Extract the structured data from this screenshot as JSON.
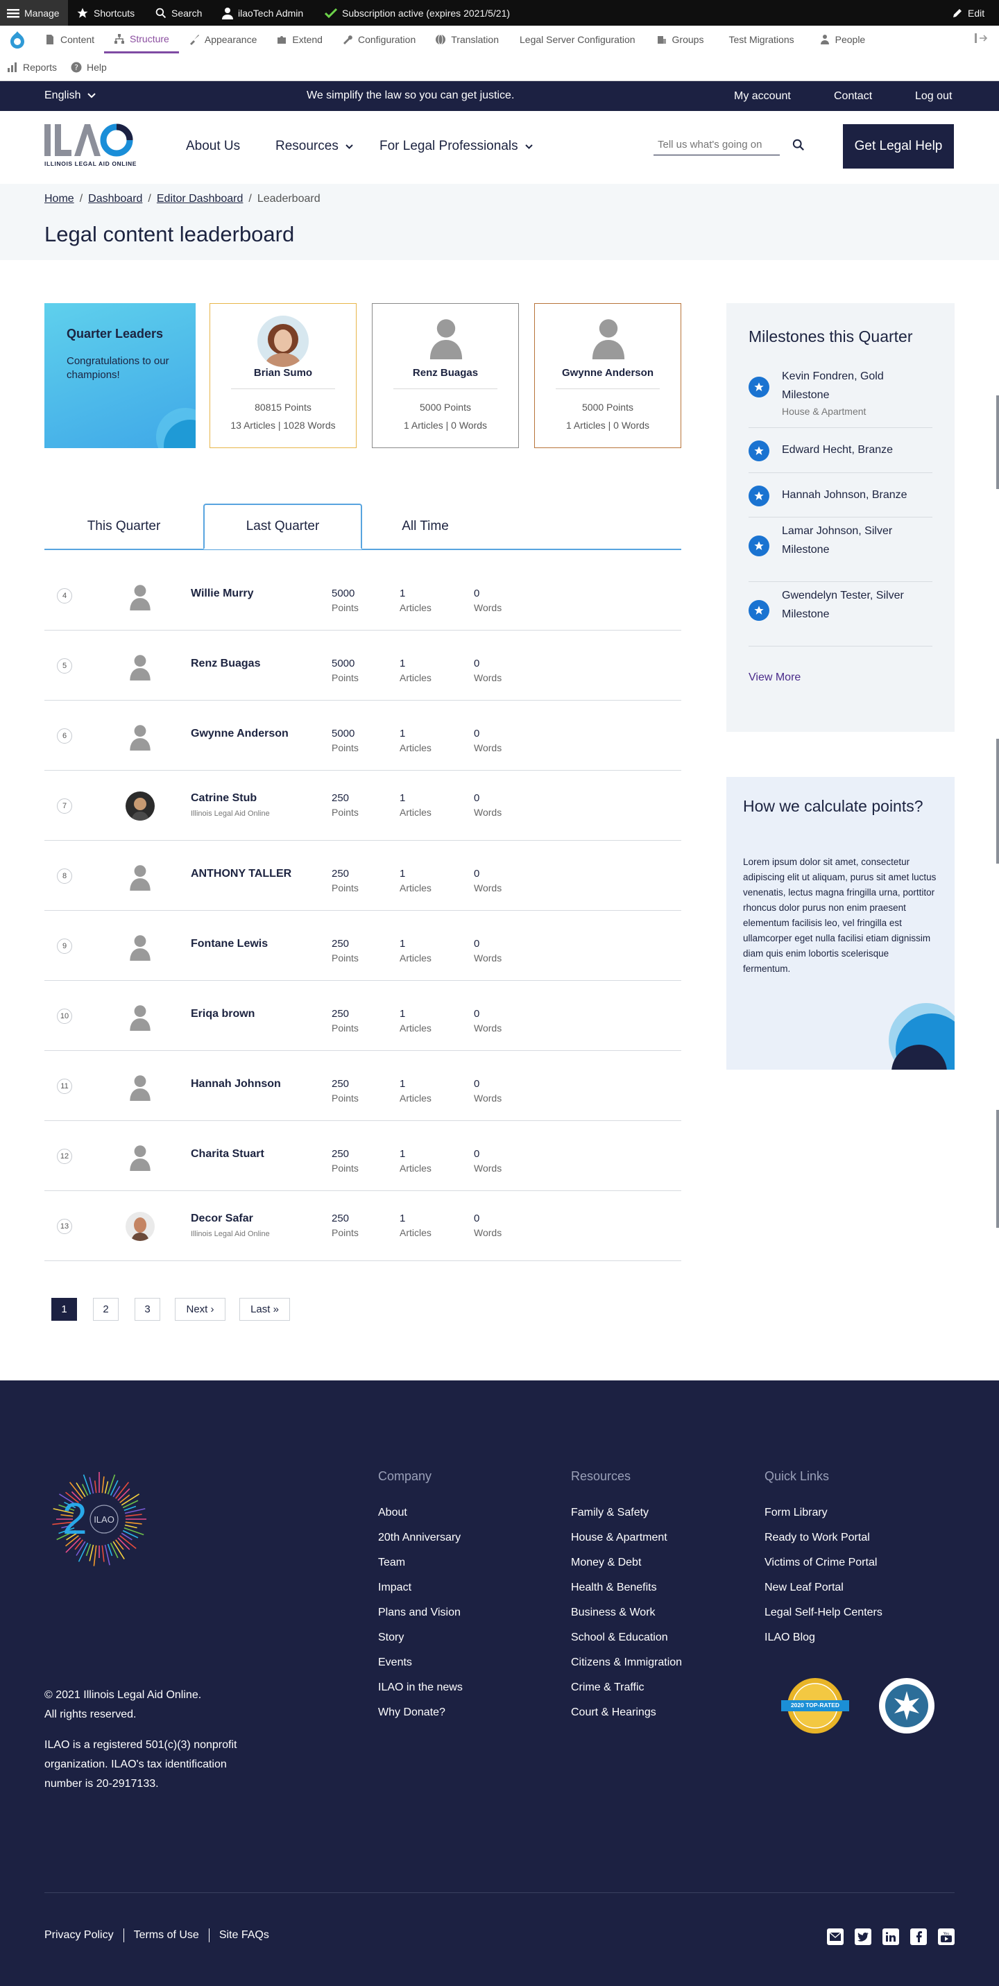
{
  "toolbar": {
    "manage": "Manage",
    "shortcuts": "Shortcuts",
    "search": "Search",
    "user": "ilaoTech Admin",
    "subscription": "Subscription active (expires 2021/5/21)",
    "edit": "Edit"
  },
  "tray": {
    "items": [
      "Content",
      "Structure",
      "Appearance",
      "Extend",
      "Configuration",
      "Translation",
      "Legal Server Configuration",
      "Groups",
      "Test Migrations",
      "People"
    ],
    "row2": [
      "Reports",
      "Help"
    ]
  },
  "util": {
    "language": "English",
    "tagline": "We simplify the law so you can get justice.",
    "my_account": "My account",
    "contact": "Contact",
    "logout": "Log out"
  },
  "header": {
    "logo_text": "ILAO",
    "logo_sub": "ILLINOIS LEGAL AID ONLINE",
    "nav": [
      "About Us",
      "Resources",
      "For Legal Professionals"
    ],
    "search_placeholder": "Tell us what's going on",
    "cta": "Get Legal Help"
  },
  "breadcrumb": [
    "Home",
    "Dashboard",
    "Editor Dashboard",
    "Leaderboard"
  ],
  "page_title": "Legal content leaderboard",
  "quarter_leaders": {
    "title": "Quarter Leaders",
    "subtitle": "Congratulations to our champions!"
  },
  "leaders": [
    {
      "name": "Brian Sumo",
      "points": "80815 Points",
      "detail": "13 Articles | 1028 Words",
      "color": "#e8b64a"
    },
    {
      "name": "Renz Buagas",
      "points": "5000 Points",
      "detail": "1 Articles | 0 Words",
      "color": "#8a8a8a"
    },
    {
      "name": "Gwynne Anderson",
      "points": "5000 Points",
      "detail": "1 Articles | 0 Words",
      "color": "#b8743a"
    }
  ],
  "tabs": [
    "This Quarter",
    "Last Quarter",
    "All Time"
  ],
  "labels": {
    "points": "Points",
    "articles": "Articles",
    "words": "Words"
  },
  "rows": [
    {
      "rank": "4",
      "name": "Willie Murry",
      "org": "",
      "points": "5000",
      "articles": "1",
      "words": "0"
    },
    {
      "rank": "5",
      "name": "Renz Buagas",
      "org": "",
      "points": "5000",
      "articles": "1",
      "words": "0"
    },
    {
      "rank": "6",
      "name": "Gwynne Anderson",
      "org": "",
      "points": "5000",
      "articles": "1",
      "words": "0"
    },
    {
      "rank": "7",
      "name": "Catrine Stub",
      "org": "Illinois Legal Aid Online",
      "points": "250",
      "articles": "1",
      "words": "0"
    },
    {
      "rank": "8",
      "name": "ANTHONY TALLER",
      "org": "",
      "points": "250",
      "articles": "1",
      "words": "0"
    },
    {
      "rank": "9",
      "name": "Fontane Lewis",
      "org": "",
      "points": "250",
      "articles": "1",
      "words": "0"
    },
    {
      "rank": "10",
      "name": "Eriqa brown",
      "org": "",
      "points": "250",
      "articles": "1",
      "words": "0"
    },
    {
      "rank": "11",
      "name": "Hannah Johnson",
      "org": "",
      "points": "250",
      "articles": "1",
      "words": "0"
    },
    {
      "rank": "12",
      "name": "Charita Stuart",
      "org": "",
      "points": "250",
      "articles": "1",
      "words": "0"
    },
    {
      "rank": "13",
      "name": "Decor Safar",
      "org": "Illinois Legal Aid Online",
      "points": "250",
      "articles": "1",
      "words": "0"
    }
  ],
  "pager": [
    "1",
    "2",
    "3",
    "Next ›",
    "Last »"
  ],
  "milestones": {
    "title": "Milestones this Quarter",
    "items": [
      {
        "text": "Kevin Fondren, Gold Milestone",
        "sub": "House & Apartment"
      },
      {
        "text": "Edward Hecht, Branze",
        "sub": ""
      },
      {
        "text": "Hannah Johnson, Branze",
        "sub": ""
      },
      {
        "text": "Lamar Johnson, Silver Milestone",
        "sub": ""
      },
      {
        "text": "Gwendelyn Tester, Silver Milestone",
        "sub": ""
      }
    ],
    "view_more": "View More"
  },
  "calc": {
    "title": "How we calculate points?",
    "body": "Lorem ipsum dolor sit amet, consectetur adipiscing elit ut aliquam, purus sit amet luctus venenatis, lectus magna fringilla urna, porttitor rhoncus dolor purus non enim praesent elementum facilisis leo, vel fringilla est ullamcorper eget nulla facilisi etiam dignissim diam quis enim lobortis scelerisque fermentum."
  },
  "footer": {
    "anniv_logo": "2 ILAO",
    "columns": [
      {
        "heading": "Company",
        "links": [
          "About",
          "20th Anniversary",
          "Team",
          "Impact",
          "Plans and Vision",
          "Story",
          "Events",
          "ILAO in the news",
          "Why Donate?"
        ]
      },
      {
        "heading": "Resources",
        "links": [
          "Family & Safety",
          "House & Apartment",
          "Money & Debt",
          "Health & Benefits",
          "Business & Work",
          "School & Education",
          "Citizens & Immigration",
          "Crime & Traffic",
          "Court & Hearings"
        ]
      },
      {
        "heading": "Quick Links",
        "links": [
          "Form Library",
          "Ready to Work Portal",
          "Victims of Crime Portal",
          "New Leaf Portal",
          "Legal Self-Help Centers",
          "ILAO Blog"
        ]
      }
    ],
    "copyright": "© 2021 Illinois Legal Aid Online.",
    "rights": "All rights reserved.",
    "nonprofit": "ILAO is a registered 501(c)(3) nonprofit organization. ILAO's tax identification number is 20-2917133.",
    "badge1": "2020 TOP-RATED",
    "bottom_links": [
      "Privacy Policy",
      "Terms of Use",
      "Site FAQs"
    ],
    "social": [
      "email-icon",
      "twitter-icon",
      "linkedin-icon",
      "facebook-icon",
      "youtube-icon"
    ]
  }
}
